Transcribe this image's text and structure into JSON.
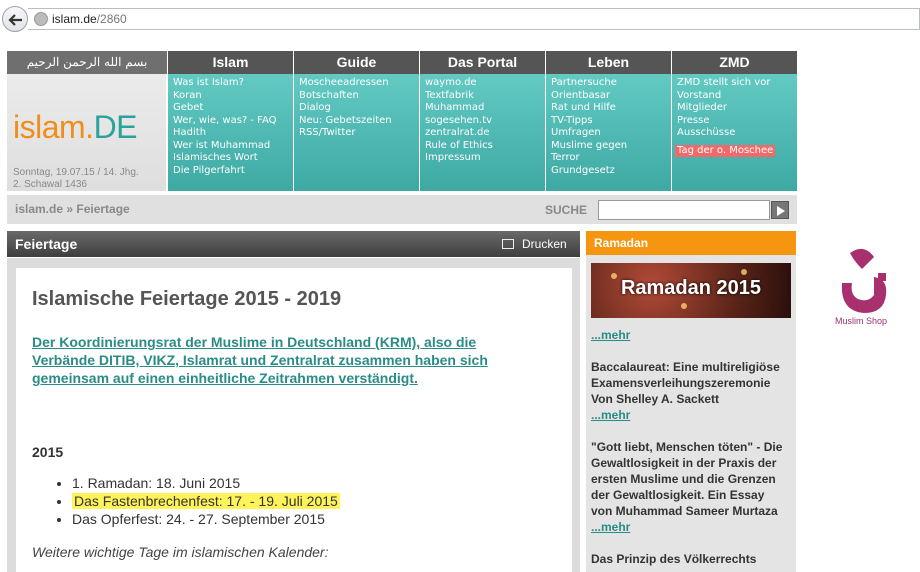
{
  "browser": {
    "url_host": "islam.de",
    "url_path": "/2860"
  },
  "header": {
    "basmala": "بسم الله الرحمن الرحيم",
    "logo_part1": "islam.",
    "logo_part2": "DE",
    "date_line1": "Sonntag, 19.07.15 / 14. Jhg.",
    "date_line2": "2. Schawal 1436"
  },
  "nav": [
    {
      "title": "Islam",
      "items": [
        "Was ist Islam?",
        "Koran",
        "Gebet",
        "Wer, wie, was? - FAQ",
        "Hadith",
        "Wer ist Muhammad",
        "Islamisches Wort",
        "Die Pilgerfahrt"
      ]
    },
    {
      "title": "Guide",
      "items": [
        "Moscheeadressen",
        "Botschaften",
        "Dialog",
        "Neu: Gebetszeiten",
        "RSS/Twitter"
      ]
    },
    {
      "title": "Das Portal",
      "items": [
        "waymo.de",
        "Textfabrik",
        "Muhammad",
        "sogesehen.tv",
        "zentralrat.de",
        "Rule of Ethics",
        "Impressum"
      ]
    },
    {
      "title": "Leben",
      "items": [
        "Partnersuche",
        "Orientbasar",
        "Rat und Hilfe",
        "TV-Tipps",
        "Umfragen",
        "Muslime gegen",
        "Terror",
        "Grundgesetz"
      ]
    },
    {
      "title": "ZMD",
      "items": [
        "ZMD stellt sich vor",
        "Vorstand",
        "Mitglieder",
        "Presse",
        "Ausschüsse",
        "Tag der o. Moschee"
      ]
    }
  ],
  "crumb": "islam.de » Feiertage",
  "search": {
    "label": "SUCHE",
    "value": ""
  },
  "main": {
    "header": "Feiertage",
    "print_label": "Drucken",
    "title": "Islamische Feiertage 2015 - 2019",
    "intro": "Der Koordinierungsrat der Muslime in Deutschland (KRM), also die Verbände DITIB, VIKZ, Islamrat und Zentralrat zusammen haben sich gemeinsam auf einen einheitliche Zeitrahmen verständigt.",
    "year": "2015",
    "holidays": [
      "1. Ramadan: 18. Juni 2015",
      "Das Fastenbrechenfest: 17. - 19. Juli 2015",
      "Das Opferfest: 24. - 27. September 2015"
    ],
    "more_days": "Weitere wichtige Tage im islamischen Kalender:"
  },
  "sidebar": {
    "header": "Ramadan",
    "banner_text": "Ramadan 2015",
    "items": [
      {
        "title": "",
        "more": "...mehr"
      },
      {
        "title": "Baccalaureat: Eine multireligiöse Examensverleihungszeremonie Von Shelley A. Sackett",
        "more": "...mehr"
      },
      {
        "title": "\"Gott liebt, Menschen töten\" - Die Gewaltlosigkeit in der Praxis der ersten Muslime und die Grenzen der Gewaltlosigkeit. Ein Essay von Muhammad Sameer Murtaza",
        "more": "...mehr"
      },
      {
        "title": "Das Prinzip des Völkerrechts",
        "more": ""
      }
    ]
  },
  "ad": {
    "label": "Muslim Shop"
  },
  "colors": {
    "teal": "#47b2ad",
    "orange": "#f6950f",
    "highlight": "#fff35a",
    "link": "#2a8c86"
  }
}
